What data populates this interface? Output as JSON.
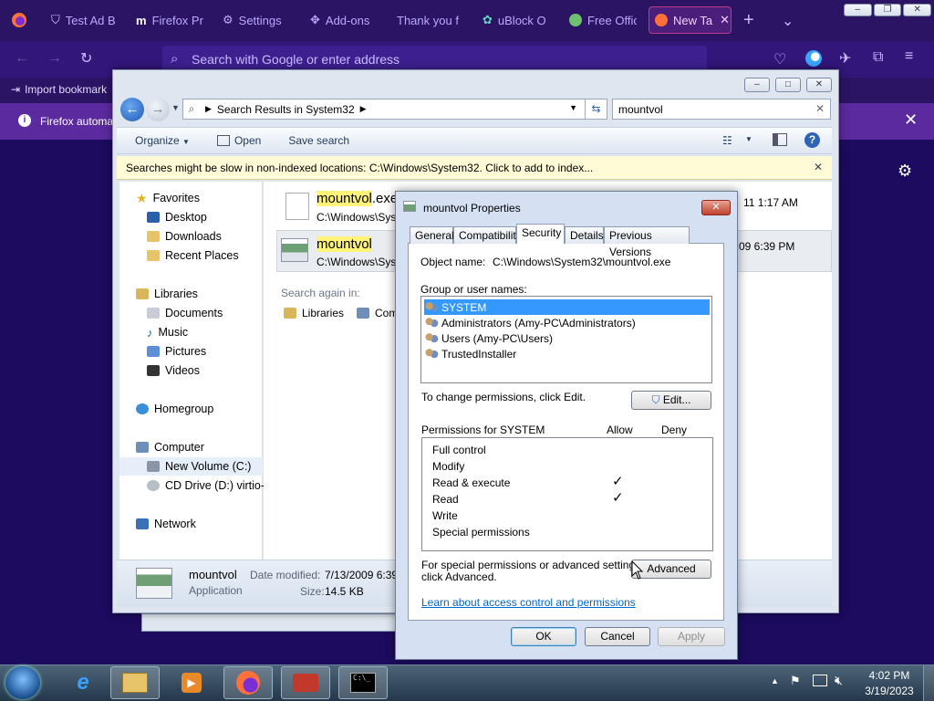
{
  "firefox": {
    "tabs": [
      {
        "label": "Test Ad B",
        "icon": "shield-icon"
      },
      {
        "label": "Firefox Pr",
        "icon": "m-icon"
      },
      {
        "label": "Settings",
        "icon": "gear-icon"
      },
      {
        "label": "Add-ons",
        "icon": "puzzle-icon"
      },
      {
        "label": "Thank you f",
        "icon": "none"
      },
      {
        "label": "uBlock O",
        "icon": "ublock-icon"
      },
      {
        "label": "Free Offic",
        "icon": "office-icon"
      },
      {
        "label": "New Ta",
        "icon": "firefox-icon"
      }
    ],
    "urlbar_placeholder": "Search with Google or enter address",
    "bookmark": "Import bookmark",
    "notice": "Firefox automa"
  },
  "explorer": {
    "address": "Search Results in System32",
    "search_value": "mountvol",
    "toolbar": {
      "organize": "Organize",
      "open": "Open",
      "save_search": "Save search"
    },
    "infobar": "Searches might be slow in non-indexed locations: C:\\Windows\\System32. Click to add to index...",
    "nav": {
      "favorites": "Favorites",
      "desktop": "Desktop",
      "downloads": "Downloads",
      "recent": "Recent Places",
      "libraries": "Libraries",
      "documents": "Documents",
      "music": "Music",
      "pictures": "Pictures",
      "videos": "Videos",
      "homegroup": "Homegroup",
      "computer": "Computer",
      "new_volume": "New Volume (C:)",
      "cd_drive": "CD Drive (D:) virtio-",
      "network": "Network"
    },
    "results": [
      {
        "name_hl": "mountvol",
        "name_rest": ".exe",
        "path": "C:\\Windows\\Sys",
        "date": "11 1:17 AM"
      },
      {
        "name_hl": "mountvol",
        "name_rest": "",
        "path": "C:\\Windows\\Sys",
        "date": "09 6:39 PM"
      }
    ],
    "search_again": "Search again in:",
    "search_again_libraries": "Libraries",
    "search_again_computer": "Com",
    "details": {
      "name": "mountvol",
      "type": "Application",
      "modified_label": "Date modified:",
      "modified": "7/13/2009 6:39",
      "size_label": "Size:",
      "size": "14.5 KB"
    }
  },
  "dialog": {
    "title": "mountvol Properties",
    "tabs": [
      "General",
      "Compatibility",
      "Security",
      "Details",
      "Previous Versions"
    ],
    "object_label": "Object name:",
    "object_value": "C:\\Windows\\System32\\mountvol.exe",
    "group_label": "Group or user names:",
    "users": [
      "SYSTEM",
      "Administrators (Amy-PC\\Administrators)",
      "Users (Amy-PC\\Users)",
      "TrustedInstaller"
    ],
    "change_text": "To change permissions, click Edit.",
    "edit_button": "Edit...",
    "perm_label": "Permissions for SYSTEM",
    "allow": "Allow",
    "deny": "Deny",
    "permissions": [
      "Full control",
      "Modify",
      "Read & execute",
      "Read",
      "Write",
      "Special permissions"
    ],
    "checkmark": "✓",
    "special_text_1": "For special permissions or advanced settings,",
    "special_text_2": "click Advanced.",
    "advanced_button": "Advanced",
    "learn_link": "Learn about access control and permissions",
    "ok": "OK",
    "cancel": "Cancel",
    "apply": "Apply"
  },
  "taskbar": {
    "time": "4:02 PM",
    "date": "3/19/2023"
  }
}
